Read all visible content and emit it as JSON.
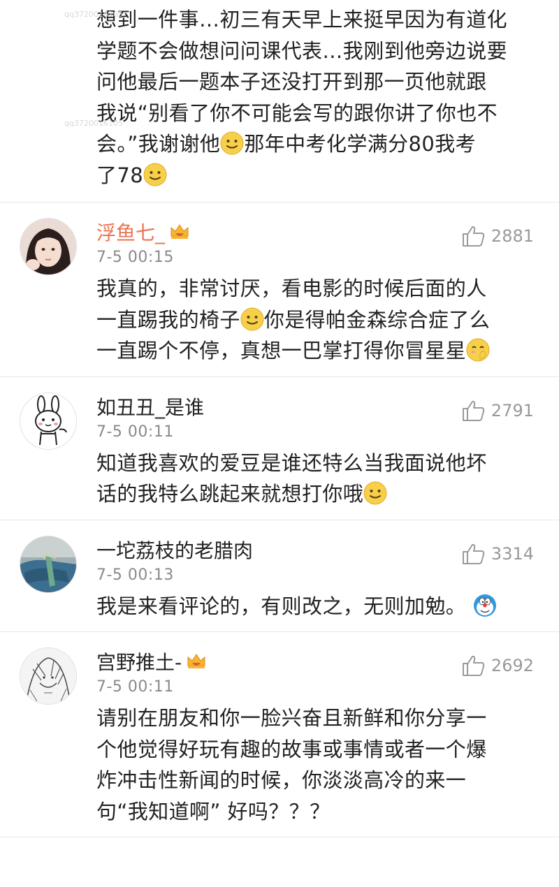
{
  "top_comment": {
    "lines": [
      "想到一件事…初三有天早上来挺早因为有道化",
      "学题不会做想问问课代表…我刚到他旁边说要",
      "问他最后一题本子还没打开到那一页他就跟",
      "我说“别看了你不可能会写的跟你讲了你也不",
      "会。”我谢谢他",
      "那年中考化学满分80我考",
      "了78"
    ]
  },
  "comments": [
    {
      "username": "浮鱼七_",
      "vip": true,
      "time": "7-5 00:15",
      "likes": "2881",
      "text1": "我真的，非常讨厌，看电影的时候后面的人",
      "text2": "一直踢我的椅子",
      "text3": "你是得帕金森综合症了么",
      "text4": "一直踢个不停，真想一巴掌打得你冒星星"
    },
    {
      "username": "如丑丑_是谁",
      "vip": false,
      "time": "7-5 00:11",
      "likes": "2791",
      "text1": "知道我喜欢的爱豆是谁还特么当我面说他坏",
      "text2": "话的我特么跳起来就想打你哦"
    },
    {
      "username": "一坨荔枝的老腊肉",
      "vip": false,
      "time": "7-5 00:13",
      "likes": "3314",
      "text1": "我是来看评论的，有则改之，无则加勉。"
    },
    {
      "username": "宫野推土-",
      "vip": true,
      "time": "7-5 00:11",
      "likes": "2692",
      "text1": "请别在朋友和你一脸兴奋且新鲜和你分享一",
      "text2": "个他觉得好玩有趣的故事或事情或者一个爆",
      "text3": "炸冲击性新闻的时候，你淡淡高冷的来一",
      "text4": "句“我知道啊” 好吗？？？"
    }
  ],
  "colors": {
    "vip_name": "#eb7350",
    "meta_gray": "#8a8a8a",
    "divider": "#e6e6e6"
  },
  "icons": [
    "smile-emoji-icon",
    "vip-crown-icon",
    "thumbs-up-icon",
    "shy-emoji-icon",
    "doraemon-emoji-icon"
  ]
}
